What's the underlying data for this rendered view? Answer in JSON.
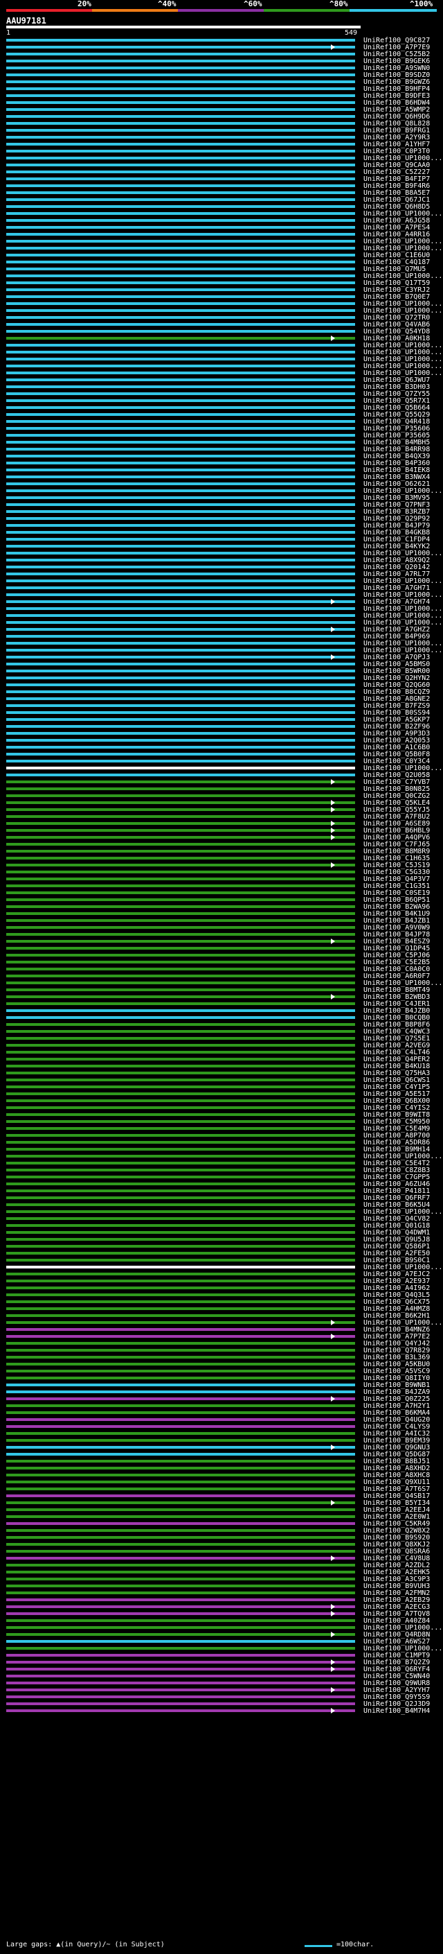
{
  "legend": {
    "labels": [
      "20%",
      "^40%",
      "^60%",
      "^80%",
      "^100%"
    ],
    "colors": [
      "#e8202a",
      "#ef7b16",
      "#8c2fa3",
      "#2f9a1d",
      "#33c6e6"
    ]
  },
  "query": {
    "id": "AAU97181",
    "start": "1",
    "end": "549"
  },
  "footer": {
    "large_gaps": "Large gaps: ▲(in Query)/~ (in Subject)",
    "scale_label": "=100char."
  },
  "hit_colors": {
    "cyan": "#33c6e6",
    "green": "#2f9a1d",
    "magenta": "#a13ab0",
    "white": "#ffffff"
  },
  "hits": [
    {
      "label": "UniRef100_Q9C827",
      "color": "cyan"
    },
    {
      "label": "UniRef100_A7P7E9",
      "color": "cyan",
      "arrow": true
    },
    {
      "label": "UniRef100_C5Z5B2",
      "color": "cyan"
    },
    {
      "label": "UniRef100_B9GEK6",
      "color": "cyan"
    },
    {
      "label": "UniRef100_A9SWN0",
      "color": "cyan"
    },
    {
      "label": "UniRef100_B9SDZ0",
      "color": "cyan"
    },
    {
      "label": "UniRef100_B9GWZ6",
      "color": "cyan"
    },
    {
      "label": "UniRef100_B9HFP4",
      "color": "cyan"
    },
    {
      "label": "UniRef100_B9DFE3",
      "color": "cyan"
    },
    {
      "label": "UniRef100_B6HDW4",
      "color": "cyan"
    },
    {
      "label": "UniRef100_A5WMP2",
      "color": "cyan"
    },
    {
      "label": "UniRef100_Q6H9D6",
      "color": "cyan"
    },
    {
      "label": "UniRef100_Q8L828",
      "color": "cyan"
    },
    {
      "label": "UniRef100_B9FRG1",
      "color": "cyan"
    },
    {
      "label": "UniRef100_A2Y9R3",
      "color": "cyan"
    },
    {
      "label": "UniRef100_A1YHF7",
      "color": "cyan"
    },
    {
      "label": "UniRef100_C0P3T0",
      "color": "cyan"
    },
    {
      "label": "UniRef100_UP1000...",
      "color": "cyan"
    },
    {
      "label": "UniRef100_Q9CAA0",
      "color": "cyan"
    },
    {
      "label": "UniRef100_C5Z227",
      "color": "cyan"
    },
    {
      "label": "UniRef100_B4FIP7",
      "color": "cyan"
    },
    {
      "label": "UniRef100_B9F4R6",
      "color": "cyan"
    },
    {
      "label": "UniRef100_B8A5E7",
      "color": "cyan"
    },
    {
      "label": "UniRef100_Q67JC1",
      "color": "cyan"
    },
    {
      "label": "UniRef100_Q6H8D5",
      "color": "cyan"
    },
    {
      "label": "UniRef100_UP1000...",
      "color": "cyan"
    },
    {
      "label": "UniRef100_A6JG58",
      "color": "cyan"
    },
    {
      "label": "UniRef100_A7PES4",
      "color": "cyan"
    },
    {
      "label": "UniRef100_A4RR16",
      "color": "cyan"
    },
    {
      "label": "UniRef100_UP1000...",
      "color": "cyan"
    },
    {
      "label": "UniRef100_UP1000...",
      "color": "cyan"
    },
    {
      "label": "UniRef100_C1E6U0",
      "color": "cyan"
    },
    {
      "label": "UniRef100_C4Q187",
      "color": "cyan"
    },
    {
      "label": "UniRef100_Q7MU5",
      "color": "cyan"
    },
    {
      "label": "UniRef100_UP1000...",
      "color": "cyan"
    },
    {
      "label": "UniRef100_Q17T59",
      "color": "cyan"
    },
    {
      "label": "UniRef100_C3YRJ2",
      "color": "cyan"
    },
    {
      "label": "UniRef100_B7Q0E7",
      "color": "cyan"
    },
    {
      "label": "UniRef100_UP1000...",
      "color": "cyan"
    },
    {
      "label": "UniRef100_UP1000...",
      "color": "cyan"
    },
    {
      "label": "UniRef100_Q72TR0",
      "color": "cyan"
    },
    {
      "label": "UniRef100_Q4VAB6",
      "color": "cyan"
    },
    {
      "label": "UniRef100_Q54YD8",
      "color": "cyan"
    },
    {
      "label": "UniRef100_A0KH18",
      "color": "green",
      "arrow": true
    },
    {
      "label": "UniRef100_UP1000...",
      "color": "cyan"
    },
    {
      "label": "UniRef100_UP1000...",
      "color": "cyan"
    },
    {
      "label": "UniRef100_UP1000...",
      "color": "cyan"
    },
    {
      "label": "UniRef100_UP1000...",
      "color": "cyan"
    },
    {
      "label": "UniRef100_UP1000...",
      "color": "cyan"
    },
    {
      "label": "UniRef100_Q6JWU7",
      "color": "cyan"
    },
    {
      "label": "UniRef100_B3DH03",
      "color": "cyan"
    },
    {
      "label": "UniRef100_Q7ZY55",
      "color": "cyan"
    },
    {
      "label": "UniRef100_Q5R7X1",
      "color": "cyan"
    },
    {
      "label": "UniRef100_Q5B664",
      "color": "cyan"
    },
    {
      "label": "UniRef100_Q55Q29",
      "color": "cyan"
    },
    {
      "label": "UniRef100_Q4R418",
      "color": "cyan"
    },
    {
      "label": "UniRef100_P35606",
      "color": "cyan"
    },
    {
      "label": "UniRef100_P35605",
      "color": "cyan"
    },
    {
      "label": "UniRef100_B4MBH5",
      "color": "cyan"
    },
    {
      "label": "UniRef100_B4RR98",
      "color": "cyan"
    },
    {
      "label": "UniRef100_B4QX39",
      "color": "cyan"
    },
    {
      "label": "UniRef100_B4P360",
      "color": "cyan"
    },
    {
      "label": "UniRef100_B4IEK8",
      "color": "cyan"
    },
    {
      "label": "UniRef100_B3NWX4",
      "color": "cyan"
    },
    {
      "label": "UniRef100_O62621",
      "color": "cyan"
    },
    {
      "label": "UniRef100_UP1000...",
      "color": "cyan"
    },
    {
      "label": "UniRef100_B3MV95",
      "color": "cyan"
    },
    {
      "label": "UniRef100_Q7PNF3",
      "color": "cyan"
    },
    {
      "label": "UniRef100_B3RZB7",
      "color": "cyan"
    },
    {
      "label": "UniRef100_Q29P92",
      "color": "cyan"
    },
    {
      "label": "UniRef100_B4JP79",
      "color": "cyan"
    },
    {
      "label": "UniRef100_B4GKB8",
      "color": "cyan"
    },
    {
      "label": "UniRef100_C1FDP4",
      "color": "cyan"
    },
    {
      "label": "UniRef100_B4KYK2",
      "color": "cyan"
    },
    {
      "label": "UniRef100_UP1000...",
      "color": "cyan"
    },
    {
      "label": "UniRef100_A8X9Q2",
      "color": "cyan"
    },
    {
      "label": "UniRef100_Q20142",
      "color": "cyan"
    },
    {
      "label": "UniRef100_A7RL77",
      "color": "cyan"
    },
    {
      "label": "UniRef100_UP1000...",
      "color": "cyan"
    },
    {
      "label": "UniRef100_A7GH71",
      "color": "cyan"
    },
    {
      "label": "UniRef100_UP1000...",
      "color": "cyan"
    },
    {
      "label": "UniRef100_A7GH74",
      "color": "cyan",
      "arrow": true
    },
    {
      "label": "UniRef100_UP1000...",
      "color": "cyan"
    },
    {
      "label": "UniRef100_UP1000...",
      "color": "cyan"
    },
    {
      "label": "UniRef100_UP1000...",
      "color": "cyan"
    },
    {
      "label": "UniRef100_A7GHZ2",
      "color": "cyan",
      "arrow": true
    },
    {
      "label": "UniRef100_B4P969",
      "color": "cyan"
    },
    {
      "label": "UniRef100_UP1000...",
      "color": "cyan"
    },
    {
      "label": "UniRef100_UP1000...",
      "color": "cyan"
    },
    {
      "label": "UniRef100_A7QPJ3",
      "color": "cyan",
      "arrow": true
    },
    {
      "label": "UniRef100_A5BMS0",
      "color": "cyan"
    },
    {
      "label": "UniRef100_B5WR00",
      "color": "cyan"
    },
    {
      "label": "UniRef100_Q2HYN2",
      "color": "cyan"
    },
    {
      "label": "UniRef100_Q2QG60",
      "color": "cyan"
    },
    {
      "label": "UniRef100_B8CQZ9",
      "color": "cyan"
    },
    {
      "label": "UniRef100_A8GNE2",
      "color": "cyan"
    },
    {
      "label": "UniRef100_B7FZS9",
      "color": "cyan"
    },
    {
      "label": "UniRef100_B0SS94",
      "color": "cyan"
    },
    {
      "label": "UniRef100_A5GKP7",
      "color": "cyan"
    },
    {
      "label": "UniRef100_B2ZF96",
      "color": "cyan"
    },
    {
      "label": "UniRef100_A9P3D3",
      "color": "cyan"
    },
    {
      "label": "UniRef100_A2Q053",
      "color": "cyan"
    },
    {
      "label": "UniRef100_A1C6B0",
      "color": "cyan"
    },
    {
      "label": "UniRef100_Q5B0F8",
      "color": "cyan"
    },
    {
      "label": "UniRef100_C0Y3C4",
      "color": "cyan"
    },
    {
      "label": "UniRef100_UP1000...",
      "color": "white"
    },
    {
      "label": "UniRef100_Q2U058",
      "color": "cyan"
    },
    {
      "label": "UniRef100_C7YVB7",
      "color": "green",
      "arrow": true
    },
    {
      "label": "UniRef100_B0N825",
      "color": "green"
    },
    {
      "label": "UniRef100_Q0CZG2",
      "color": "green"
    },
    {
      "label": "UniRef100_Q5KLE4",
      "color": "green",
      "arrow": true
    },
    {
      "label": "UniRef100_Q55YJ5",
      "color": "green",
      "arrow": true
    },
    {
      "label": "UniRef100_A7F8U2",
      "color": "green"
    },
    {
      "label": "UniRef100_A6SE89",
      "color": "green",
      "arrow": true
    },
    {
      "label": "UniRef100_B6HBL9",
      "color": "green",
      "arrow": true
    },
    {
      "label": "UniRef100_A4QPV6",
      "color": "green",
      "arrow": true
    },
    {
      "label": "UniRef100_C7FJ65",
      "color": "green"
    },
    {
      "label": "UniRef100_B8M8R9",
      "color": "green"
    },
    {
      "label": "UniRef100_C1H635",
      "color": "green"
    },
    {
      "label": "UniRef100_C5JS19",
      "color": "green",
      "arrow": true
    },
    {
      "label": "UniRef100_C5G330",
      "color": "green"
    },
    {
      "label": "UniRef100_Q4P3V7",
      "color": "green"
    },
    {
      "label": "UniRef100_C1G351",
      "color": "green"
    },
    {
      "label": "UniRef100_C0SE19",
      "color": "green"
    },
    {
      "label": "UniRef100_B6QP51",
      "color": "green"
    },
    {
      "label": "UniRef100_B2WA96",
      "color": "green"
    },
    {
      "label": "UniRef100_B4K1U9",
      "color": "green"
    },
    {
      "label": "UniRef100_B4JZB1",
      "color": "green"
    },
    {
      "label": "UniRef100_A9V0W9",
      "color": "green"
    },
    {
      "label": "UniRef100_B4JP78",
      "color": "green"
    },
    {
      "label": "UniRef100_B4ESZ9",
      "color": "green",
      "arrow": true
    },
    {
      "label": "UniRef100_Q1DP45",
      "color": "green"
    },
    {
      "label": "UniRef100_C5PJ06",
      "color": "green"
    },
    {
      "label": "UniRef100_C5E2B5",
      "color": "green"
    },
    {
      "label": "UniRef100_C0A0C0",
      "color": "green"
    },
    {
      "label": "UniRef100_A6R0F7",
      "color": "green"
    },
    {
      "label": "UniRef100_UP1000...",
      "color": "green"
    },
    {
      "label": "UniRef100_B8MT49",
      "color": "green"
    },
    {
      "label": "UniRef100_B2WBD3",
      "color": "green",
      "arrow": true
    },
    {
      "label": "UniRef100_C4JER1",
      "color": "green"
    },
    {
      "label": "UniRef100_B4JZB0",
      "color": "cyan"
    },
    {
      "label": "UniRef100_B0CQB0",
      "color": "cyan"
    },
    {
      "label": "UniRef100_B8P8F6",
      "color": "green"
    },
    {
      "label": "UniRef100_C4QWC3",
      "color": "green"
    },
    {
      "label": "UniRef100_Q7S5E1",
      "color": "green"
    },
    {
      "label": "UniRef100_A2VEG9",
      "color": "green"
    },
    {
      "label": "UniRef100_C4LT46",
      "color": "green"
    },
    {
      "label": "UniRef100_Q4PER2",
      "color": "green"
    },
    {
      "label": "UniRef100_B4KU18",
      "color": "green"
    },
    {
      "label": "UniRef100_Q75HA3",
      "color": "green"
    },
    {
      "label": "UniRef100_Q6CWS1",
      "color": "green"
    },
    {
      "label": "UniRef100_C4Y1P5",
      "color": "green"
    },
    {
      "label": "UniRef100_A5E517",
      "color": "green"
    },
    {
      "label": "UniRef100_Q6BX00",
      "color": "green"
    },
    {
      "label": "UniRef100_C4YIS2",
      "color": "green"
    },
    {
      "label": "UniRef100_B9WIT8",
      "color": "green"
    },
    {
      "label": "UniRef100_C5M950",
      "color": "green"
    },
    {
      "label": "UniRef100_C5E4M9",
      "color": "green"
    },
    {
      "label": "UniRef100_A8P700",
      "color": "green"
    },
    {
      "label": "UniRef100_A5DR86",
      "color": "green"
    },
    {
      "label": "UniRef100_B9MH14",
      "color": "green"
    },
    {
      "label": "UniRef100_UP1000...",
      "color": "green"
    },
    {
      "label": "UniRef100_C5E4T2",
      "color": "green"
    },
    {
      "label": "UniRef100_C8Z8B3",
      "color": "green"
    },
    {
      "label": "UniRef100_C7GPP5",
      "color": "green"
    },
    {
      "label": "UniRef100_A6ZU46",
      "color": "green"
    },
    {
      "label": "UniRef100_P41811",
      "color": "green"
    },
    {
      "label": "UniRef100_Q6FRF7",
      "color": "green"
    },
    {
      "label": "UniRef100_B6K5U4",
      "color": "green"
    },
    {
      "label": "UniRef100_UP1000...",
      "color": "green"
    },
    {
      "label": "UniRef100_Q4CV82",
      "color": "green"
    },
    {
      "label": "UniRef100_Q01G18",
      "color": "green"
    },
    {
      "label": "UniRef100_Q4DWM1",
      "color": "green"
    },
    {
      "label": "UniRef100_Q9U5J8",
      "color": "green"
    },
    {
      "label": "UniRef100_Q586P1",
      "color": "green"
    },
    {
      "label": "UniRef100_A2FE50",
      "color": "green"
    },
    {
      "label": "UniRef100_B9S0C1",
      "color": "green"
    },
    {
      "label": "UniRef100_UP1000...",
      "color": "white"
    },
    {
      "label": "UniRef100_A7EJC2",
      "color": "green"
    },
    {
      "label": "UniRef100_A2E937",
      "color": "green"
    },
    {
      "label": "UniRef100_A4I962",
      "color": "green"
    },
    {
      "label": "UniRef100_Q4Q3L5",
      "color": "green"
    },
    {
      "label": "UniRef100_Q6CX75",
      "color": "green"
    },
    {
      "label": "UniRef100_A4HMZ8",
      "color": "green"
    },
    {
      "label": "UniRef100_B6K2H1",
      "color": "green"
    },
    {
      "label": "UniRef100_UP1000...",
      "color": "green",
      "arrow": true
    },
    {
      "label": "UniRef100_B4MNZ6",
      "color": "magenta"
    },
    {
      "label": "UniRef100_A7P7E2",
      "color": "magenta",
      "arrow": true
    },
    {
      "label": "UniRef100_Q4YJ42",
      "color": "green"
    },
    {
      "label": "UniRef100_Q7R829",
      "color": "green"
    },
    {
      "label": "UniRef100_B3L369",
      "color": "green"
    },
    {
      "label": "UniRef100_A5KBU0",
      "color": "green"
    },
    {
      "label": "UniRef100_A5VSC9",
      "color": "green"
    },
    {
      "label": "UniRef100_Q8IIY0",
      "color": "green"
    },
    {
      "label": "UniRef100_B9WNB1",
      "color": "cyan"
    },
    {
      "label": "UniRef100_B4JZA9",
      "color": "cyan"
    },
    {
      "label": "UniRef100_Q0Z225",
      "color": "magenta",
      "arrow": true
    },
    {
      "label": "UniRef100_A7H2Y1",
      "color": "green"
    },
    {
      "label": "UniRef100_B6KMA4",
      "color": "green"
    },
    {
      "label": "UniRef100_Q4UG20",
      "color": "magenta"
    },
    {
      "label": "UniRef100_C4LYS9",
      "color": "magenta"
    },
    {
      "label": "UniRef100_A4IC32",
      "color": "green"
    },
    {
      "label": "UniRef100_B9EM39",
      "color": "green"
    },
    {
      "label": "UniRef100_Q9GNU3",
      "color": "cyan",
      "arrow": true
    },
    {
      "label": "UniRef100_Q5DG87",
      "color": "cyan"
    },
    {
      "label": "UniRef100_B8BJ51",
      "color": "green"
    },
    {
      "label": "UniRef100_A8XHD2",
      "color": "green"
    },
    {
      "label": "UniRef100_A8XHC8",
      "color": "green"
    },
    {
      "label": "UniRef100_Q9XU11",
      "color": "green"
    },
    {
      "label": "UniRef100_A7T6S7",
      "color": "green"
    },
    {
      "label": "UniRef100_Q4SB17",
      "color": "magenta"
    },
    {
      "label": "UniRef100_B5YI34",
      "color": "green",
      "arrow": true
    },
    {
      "label": "UniRef100_A2EEJ4",
      "color": "green"
    },
    {
      "label": "UniRef100_A2E0W1",
      "color": "green"
    },
    {
      "label": "UniRef100_C5KR49",
      "color": "magenta"
    },
    {
      "label": "UniRef100_Q2W8X2",
      "color": "green"
    },
    {
      "label": "UniRef100_B9S920",
      "color": "green"
    },
    {
      "label": "UniRef100_Q8XKJ2",
      "color": "green"
    },
    {
      "label": "UniRef100_Q8SRA6",
      "color": "green"
    },
    {
      "label": "UniRef100_C4V8U8",
      "color": "magenta",
      "arrow": true
    },
    {
      "label": "UniRef100_A2ZDL2",
      "color": "green"
    },
    {
      "label": "UniRef100_A2EHK5",
      "color": "green"
    },
    {
      "label": "UniRef100_A3C9P3",
      "color": "green"
    },
    {
      "label": "UniRef100_B9VUH3",
      "color": "green"
    },
    {
      "label": "UniRef100_A2FMN2",
      "color": "green"
    },
    {
      "label": "UniRef100_A2EB29",
      "color": "magenta"
    },
    {
      "label": "UniRef100_A2ECG3",
      "color": "magenta",
      "arrow": true
    },
    {
      "label": "UniRef100_A7TQV8",
      "color": "magenta",
      "arrow": true
    },
    {
      "label": "UniRef100_A40Z84",
      "color": "green"
    },
    {
      "label": "UniRef100_UP1000...",
      "color": "green"
    },
    {
      "label": "UniRef100_Q4RD8N",
      "color": "green",
      "arrow": true
    },
    {
      "label": "UniRef100_A6WS27",
      "color": "cyan"
    },
    {
      "label": "UniRef100_UP1000...",
      "color": "green"
    },
    {
      "label": "UniRef100_C1MPT9",
      "color": "magenta"
    },
    {
      "label": "UniRef100_B7Q2Z9",
      "color": "magenta",
      "arrow": true
    },
    {
      "label": "UniRef100_Q6RYF4",
      "color": "magenta",
      "arrow": true
    },
    {
      "label": "UniRef100_C5WN40",
      "color": "magenta"
    },
    {
      "label": "UniRef100_Q9WUR8",
      "color": "magenta"
    },
    {
      "label": "UniRef100_A2YYH7",
      "color": "magenta",
      "arrow": true
    },
    {
      "label": "UniRef100_Q9Y5S9",
      "color": "magenta"
    },
    {
      "label": "UniRef100_Q2J3D9",
      "color": "magenta"
    },
    {
      "label": "UniRef100_B4M7H4",
      "color": "magenta",
      "arrow": true
    }
  ]
}
